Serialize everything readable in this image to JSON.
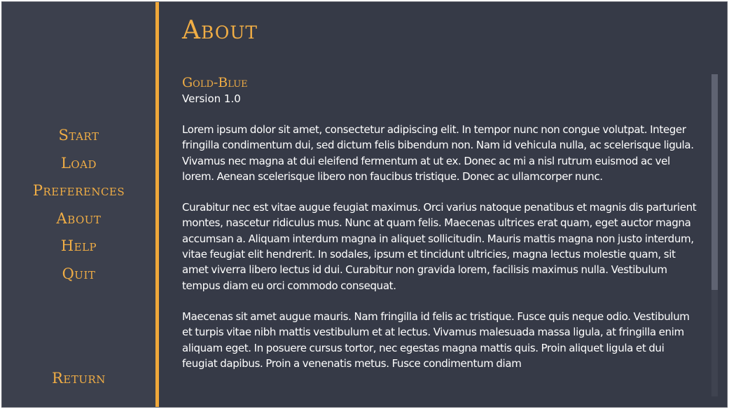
{
  "nav": {
    "items": [
      {
        "label": "Start"
      },
      {
        "label": "Load"
      },
      {
        "label": "Preferences"
      },
      {
        "label": "About"
      },
      {
        "label": "Help"
      },
      {
        "label": "Quit"
      }
    ],
    "return_label": "Return"
  },
  "page": {
    "title": "About",
    "app_name": "Gold-Blue",
    "version": "Version 1.0",
    "paragraphs": [
      "Lorem ipsum dolor sit amet, consectetur adipiscing elit. In tempor nunc non congue volutpat. Integer fringilla condimentum dui, sed dictum felis bibendum non. Nam id vehicula nulla, ac scelerisque ligula. Vivamus nec magna at dui eleifend fermentum at ut ex. Donec ac mi a nisl rutrum euismod ac vel lorem. Aenean scelerisque libero non faucibus tristique. Donec ac ullamcorper nunc.",
      "Curabitur nec est vitae augue feugiat maximus. Orci varius natoque penatibus et magnis dis parturient montes, nascetur ridiculus mus. Nunc at quam felis. Maecenas ultrices erat quam, eget auctor magna accumsan a. Aliquam interdum magna in aliquet sollicitudin. Mauris mattis magna non justo interdum, vitae feugiat elit hendrerit. In sodales, ipsum et tincidunt ultricies, magna lectus molestie quam, sit amet viverra libero lectus id dui. Curabitur non gravida lorem, facilisis maximus nulla. Vestibulum tempus diam eu orci commodo consequat.",
      "Maecenas sit amet augue mauris. Nam fringilla id felis ac tristique. Fusce quis neque odio. Vestibulum et turpis vitae nibh mattis vestibulum et at lectus. Vivamus malesuada massa ligula, at fringilla enim aliquam eget. In posuere cursus tortor, nec egestas magna mattis quis. Proin aliquet ligula et dui feugiat dapibus. Proin a venenatis metus. Fusce condimentum diam"
    ]
  },
  "scroll": {
    "position_fraction": 0.0,
    "visible_fraction": 0.67
  },
  "colors": {
    "accent": "#f0ad45",
    "background": "#363a47",
    "sidebar": "#3c404d",
    "text": "#ffffff"
  }
}
